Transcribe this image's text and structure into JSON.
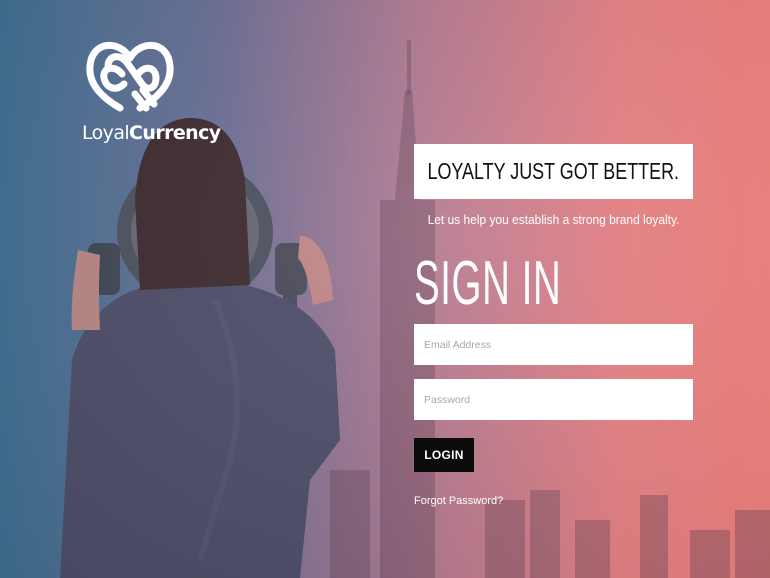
{
  "brand": {
    "name_part1": "Loyal",
    "name_part2": "Currency",
    "logo_icon": "loyalcurrency-knot-logo"
  },
  "hero": {
    "tagline": "LOYALTY JUST GOT BETTER.",
    "subtitle": "Let us help you establish a strong brand loyalty."
  },
  "signin": {
    "title": "SIGN IN",
    "email_placeholder": "Email Address",
    "email_value": "",
    "password_placeholder": "Password",
    "password_value": "",
    "login_label": "LOGIN",
    "forgot_label": "Forgot Password?"
  },
  "colors": {
    "gradient_left": "#3f7093",
    "gradient_mid": "#b27990",
    "gradient_right": "#f07f7c",
    "button": "#0b0b0b",
    "text_light": "#ffffff"
  }
}
